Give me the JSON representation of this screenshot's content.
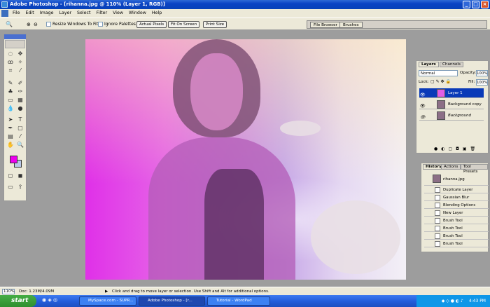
{
  "window": {
    "title": "Adobe Photoshop - [rihanna.jpg @ 110% (Layer 1, RGB)]"
  },
  "menu": [
    "File",
    "Edit",
    "Image",
    "Layer",
    "Select",
    "Filter",
    "View",
    "Window",
    "Help"
  ],
  "options": {
    "resize_windows": "Resize Windows To Fit",
    "ignore_palettes": "Ignore Palettes",
    "actual_pixels": "Actual Pixels",
    "fit_on_screen": "Fit On Screen",
    "print_size": "Print Size"
  },
  "palette_well": {
    "tabs": [
      "File Browser",
      "Brushes"
    ]
  },
  "layers_panel": {
    "tabs": [
      "Layers",
      "Channels"
    ],
    "blend_mode": "Normal",
    "opacity_label": "Opacity:",
    "opacity": "100%",
    "lock_label": "Lock:",
    "fill_label": "Fill:",
    "fill": "100%",
    "layers": [
      {
        "name": "Layer 1",
        "selected": true
      },
      {
        "name": "Background copy",
        "selected": false
      },
      {
        "name": "Background",
        "selected": false
      }
    ]
  },
  "history_panel": {
    "tabs": [
      "History",
      "Actions",
      "Tool Presets"
    ],
    "snapshot": "rihanna.jpg",
    "steps": [
      "Duplicate Layer",
      "Gaussian Blur",
      "Blending Options",
      "New Layer",
      "Brush Tool",
      "Brush Tool",
      "Brush Tool",
      "Brush Tool"
    ]
  },
  "status": {
    "zoom": "110%",
    "doc": "Doc: 1.23M/4.09M",
    "hint": "Click and drag to move layer or selection. Use Shift and Alt for additional options."
  },
  "taskbar": {
    "start": "start",
    "tasks": [
      "MySpace.com - SUPR...",
      "Adobe Photoshop - [r...",
      "Tutorial - WordPad"
    ],
    "clock": "4:43 PM"
  },
  "colors": {
    "foreground": "#ee00ee",
    "background": "#b8c8e8",
    "titlebar": "#0a43c4"
  }
}
